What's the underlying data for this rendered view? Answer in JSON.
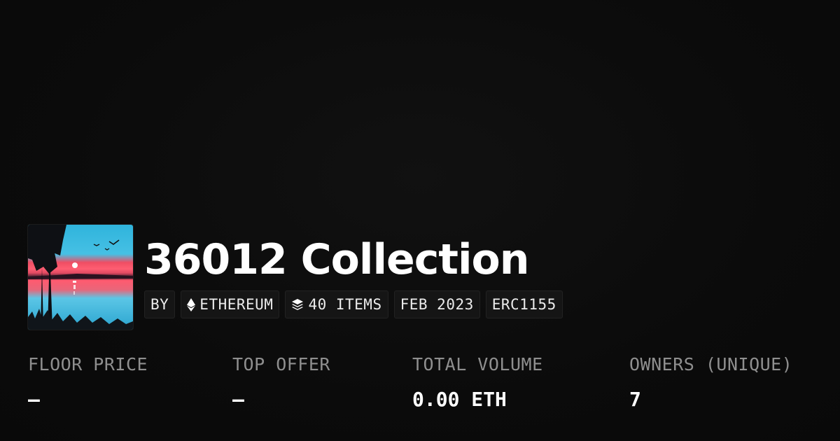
{
  "collection": {
    "title": "36012 Collection",
    "thumbnail_icon": "landscape-painting-thumbnail"
  },
  "chips": {
    "by": "BY",
    "chain": "ETHEREUM",
    "chain_icon": "ethereum-icon",
    "items": "40 ITEMS",
    "items_icon": "layers-icon",
    "date": "FEB 2023",
    "standard": "ERC1155"
  },
  "stats": {
    "floor_price": {
      "label": "FLOOR PRICE",
      "value": "–"
    },
    "top_offer": {
      "label": "TOP OFFER",
      "value": "–"
    },
    "total_volume": {
      "label": "TOTAL VOLUME",
      "value": "0.00 ETH"
    },
    "owners": {
      "label": "OWNERS (UNIQUE)",
      "value": "7"
    }
  },
  "colors": {
    "background": "#0b0b0b",
    "chip_background": "#151515",
    "label_gray": "#8f8f8f",
    "text_white": "#ffffff"
  }
}
